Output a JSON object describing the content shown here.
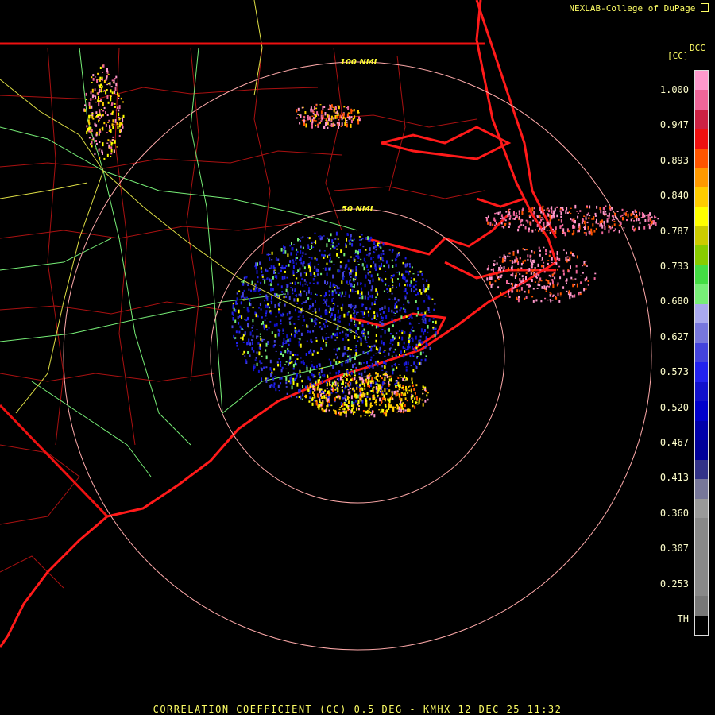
{
  "header": {
    "credit": "NEXLAB-College of DuPage"
  },
  "footer": {
    "caption": "CORRELATION COEFFICIENT (CC) 0.5 DEG - KMHX 12 DEC 25 11:32"
  },
  "legend": {
    "abbr": "DCC",
    "unit": "[CC]",
    "ticks": [
      "1.000",
      "0.947",
      "0.893",
      "0.840",
      "0.787",
      "0.733",
      "0.680",
      "0.627",
      "0.573",
      "0.520",
      "0.467",
      "0.413",
      "0.360",
      "0.307",
      "0.253",
      "TH"
    ],
    "colors": [
      "#ff99cc",
      "#ee6699",
      "#cc2244",
      "#ee1111",
      "#ff5500",
      "#ff9900",
      "#ffcc00",
      "#ffff00",
      "#cccc00",
      "#88cc00",
      "#44dd44",
      "#77ee77",
      "#aaaaee",
      "#7777dd",
      "#4444dd",
      "#2222ee",
      "#1111cc",
      "#0000cc",
      "#0000aa",
      "#000099",
      "#333388",
      "#777799",
      "#999999",
      "#888888",
      "#888888",
      "#888888",
      "#888888",
      "#777777",
      "#000000"
    ]
  },
  "range_rings": [
    {
      "label": "50 NMI"
    },
    {
      "label": "100 NMI"
    }
  ],
  "colors": {
    "coast": "#ff1a1a",
    "state_line": "#ee1111",
    "county": "#aa1111",
    "highway": "#77ee77",
    "road": "#dddd44",
    "ring": "#ffaaaa"
  }
}
